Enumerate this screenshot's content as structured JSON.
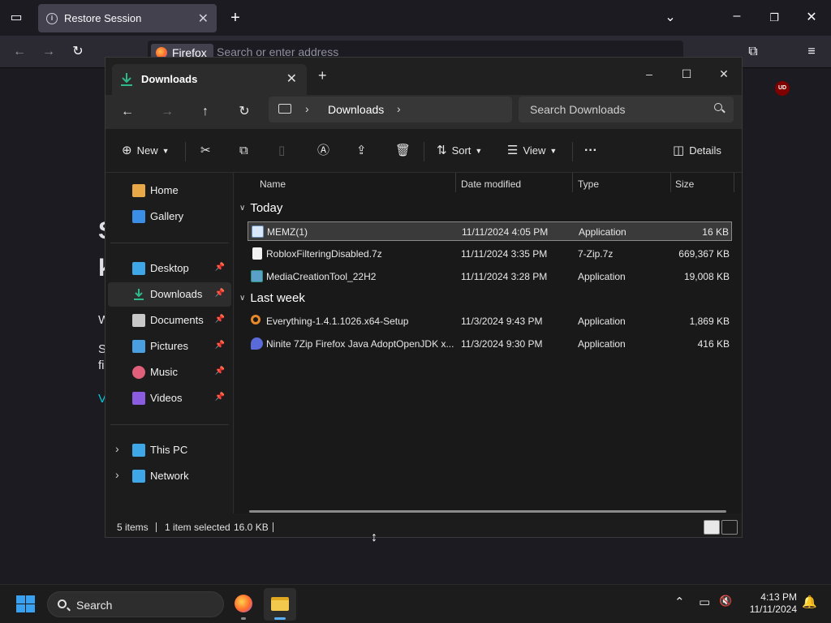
{
  "firefox": {
    "tab_title": "Restore Session",
    "url_badge": "Firefox",
    "url_placeholder": "Search or enter address",
    "ublock_badge": "UD",
    "bg_letters": [
      "S",
      "k",
      "W",
      "S",
      "fi",
      "V"
    ]
  },
  "explorer": {
    "tab_title": "Downloads",
    "breadcrumb": "Downloads",
    "search_placeholder": "Search Downloads",
    "commands": {
      "new": "New",
      "sort": "Sort",
      "view": "View",
      "more": "···",
      "details": "Details"
    },
    "navpane": {
      "items": [
        {
          "label": "Home",
          "icon": "home-icon",
          "pinned": false,
          "color": "#e8a848"
        },
        {
          "label": "Gallery",
          "icon": "gallery-icon",
          "pinned": false,
          "color": "#3a8ee6"
        },
        {
          "label": "Desktop",
          "icon": "desktop-icon",
          "pinned": true,
          "color": "#3fa7e8"
        },
        {
          "label": "Downloads",
          "icon": "downloads-icon",
          "pinned": true,
          "color": "#2fb88c"
        },
        {
          "label": "Documents",
          "icon": "documents-icon",
          "pinned": true,
          "color": "#c8c8c8"
        },
        {
          "label": "Pictures",
          "icon": "pictures-icon",
          "pinned": true,
          "color": "#4a9fe0"
        },
        {
          "label": "Music",
          "icon": "music-icon",
          "pinned": true,
          "color": "#e0607a"
        },
        {
          "label": "Videos",
          "icon": "videos-icon",
          "pinned": true,
          "color": "#8a5ce0"
        },
        {
          "label": "This PC",
          "icon": "this-pc-icon",
          "pinned": false,
          "color": "#3fa7e8"
        },
        {
          "label": "Network",
          "icon": "network-icon",
          "pinned": false,
          "color": "#3fa7e8"
        }
      ]
    },
    "columns": {
      "name": "Name",
      "date": "Date modified",
      "type": "Type",
      "size": "Size"
    },
    "groups": [
      {
        "label": "Today",
        "files": [
          {
            "name": "MEMZ(1)",
            "date": "11/11/2024 4:05 PM",
            "type": "Application",
            "size": "16 KB",
            "icon": "application-icon",
            "selected": true
          },
          {
            "name": "RobloxFilteringDisabled.7z",
            "date": "11/11/2024 3:35 PM",
            "type": "7-Zip.7z",
            "size": "669,367 KB",
            "icon": "file-icon",
            "selected": false
          },
          {
            "name": "MediaCreationTool_22H2",
            "date": "11/11/2024 3:28 PM",
            "type": "Application",
            "size": "19,008 KB",
            "icon": "installer-icon",
            "selected": false
          }
        ]
      },
      {
        "label": "Last week",
        "files": [
          {
            "name": "Everything-1.4.1.1026.x64-Setup",
            "date": "11/3/2024 9:43 PM",
            "type": "Application",
            "size": "1,869 KB",
            "icon": "everything-icon",
            "selected": false
          },
          {
            "name": "Ninite 7Zip Firefox Java AdoptOpenJDK x...",
            "date": "11/3/2024 9:30 PM",
            "type": "Application",
            "size": "416 KB",
            "icon": "ninite-icon",
            "selected": false
          }
        ]
      }
    ],
    "status": {
      "items": "5 items",
      "selected": "1 item selected",
      "size": "16.0 KB"
    }
  },
  "taskbar": {
    "search_label": "Search",
    "time": "4:13 PM",
    "date": "11/11/2024"
  }
}
